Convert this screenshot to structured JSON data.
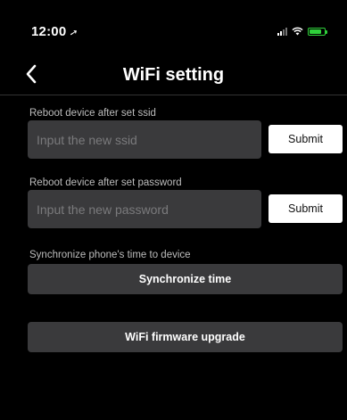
{
  "status_bar": {
    "time": "12:00",
    "location_glyph": "➚",
    "battery_level": 0.8,
    "battery_color": "#2fd13b"
  },
  "nav": {
    "title": "WiFi setting",
    "back_icon": "chevron-left-icon"
  },
  "ssid": {
    "label": "Reboot device after set ssid",
    "placeholder": "Input the new ssid",
    "value": "",
    "submit_label": "Submit"
  },
  "password": {
    "label": "Reboot device after set password",
    "placeholder": "Input the new password",
    "value": "",
    "submit_label": "Submit"
  },
  "time_sync": {
    "label": "Synchronize phone's time to device",
    "button_label": "Synchronize time"
  },
  "firmware": {
    "button_label": "WiFi firmware upgrade"
  },
  "colors": {
    "background": "#000000",
    "field_background": "#3a3a3c",
    "primary_button": "#ffffff"
  }
}
